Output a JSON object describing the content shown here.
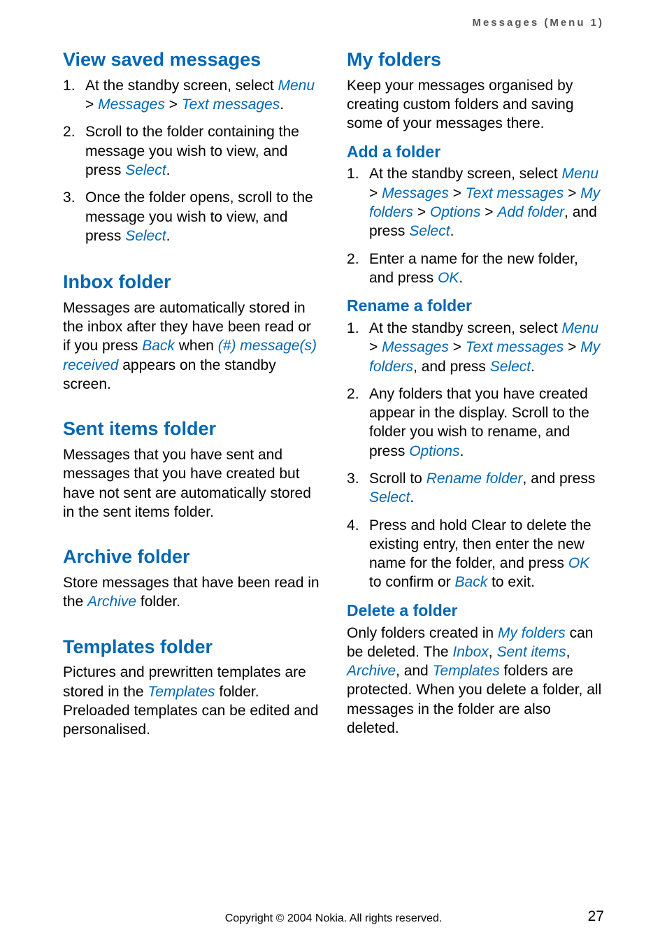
{
  "header": {
    "running": "Messages (Menu 1)"
  },
  "gt": ">",
  "ui": {
    "menu": "Menu",
    "messages": "Messages",
    "text_messages": "Text messages",
    "select": "Select",
    "back": "Back",
    "ok": "OK",
    "options": "Options",
    "my_folders": "My folders",
    "add_folder": "Add folder",
    "rename_folder": "Rename folder",
    "archive": "Archive",
    "templates": "Templates",
    "inbox": "Inbox",
    "sent_items": "Sent items",
    "msgs_received": "(#) message(s) received"
  },
  "left": {
    "view_saved": {
      "title": "View saved messages",
      "s1a": "At the standby screen, select ",
      "s2a": "Scroll to the folder containing the message you wish to view, and press ",
      "s3a": "Once the folder opens, scroll to the message you wish to view, and press "
    },
    "inbox": {
      "title": "Inbox folder",
      "p1a": "Messages are automatically stored in the inbox after they have been read or if you press ",
      "p1b": " when ",
      "p1c": " appears on the standby screen."
    },
    "sent": {
      "title": "Sent items folder",
      "p1": "Messages that you have sent and messages that you have created but have not sent are automatically stored in the sent items folder."
    },
    "archive": {
      "title": "Archive folder",
      "p1a": "Store messages that have been read in the ",
      "p1b": " folder."
    },
    "templates": {
      "title": "Templates folder",
      "p1a": "Pictures and prewritten templates are stored in the ",
      "p1b": " folder. Preloaded templates can be edited and personalised."
    }
  },
  "right": {
    "myfolders": {
      "title": "My folders",
      "p1": "Keep your messages organised by creating custom folders and saving some of your messages there."
    },
    "addfolder": {
      "title": "Add a folder",
      "s1a": "At the standby screen, select ",
      "s1b": ", and press ",
      "s2a": "Enter a name for the new folder, and press "
    },
    "renamefolder": {
      "title": "Rename a folder",
      "s1a": "At the standby screen, select ",
      "s1b": ", and press ",
      "s2a": "Any folders that you have created appear in the display. Scroll to the folder you wish to rename, and press ",
      "s3a": "Scroll to ",
      "s3b": ", and press ",
      "s4a": "Press and hold Clear to delete the existing entry, then enter the new name for the folder, and press ",
      "s4b": " to confirm or ",
      "s4c": " to exit."
    },
    "deletefolder": {
      "title": "Delete a folder",
      "p1a": "Only folders created in ",
      "p1b": " can be deleted. The ",
      "p1c": ", ",
      "p1d": ", ",
      "p1e": ", and ",
      "p1f": " folders are protected. When you delete a folder, all messages in the folder are also deleted."
    }
  },
  "footer": {
    "copyright": "Copyright © 2004 Nokia. All rights reserved.",
    "page": "27"
  }
}
